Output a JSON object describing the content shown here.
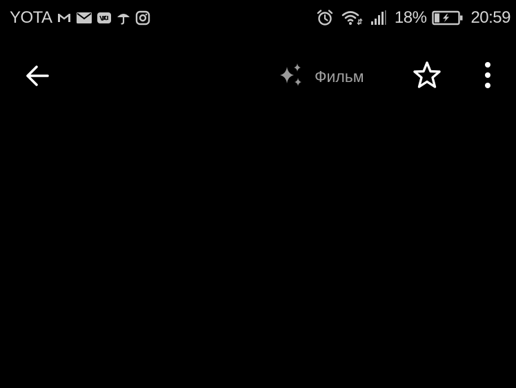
{
  "status_bar": {
    "carrier": "YOTA",
    "notification_icons": [
      "gmail-icon",
      "mail-icon",
      "vk-icon",
      "umbrella-icon",
      "instagram-icon"
    ],
    "system_icons": [
      "alarm-icon",
      "wifi-icon",
      "signal-icon"
    ],
    "battery_percent": "18%",
    "battery_icon": "battery-charging-icon",
    "time": "20:59"
  },
  "app_bar": {
    "back_icon": "arrow-left-icon",
    "film_chip": {
      "icon": "sparkle-icon",
      "label": "Фильм"
    },
    "favorite_icon": "star-outline-icon",
    "more_icon": "more-vert-icon"
  },
  "colors": {
    "background": "#000000",
    "status_text": "#d6d6d6",
    "chip_text": "#a2a2a2",
    "icon_white": "#ffffff"
  }
}
